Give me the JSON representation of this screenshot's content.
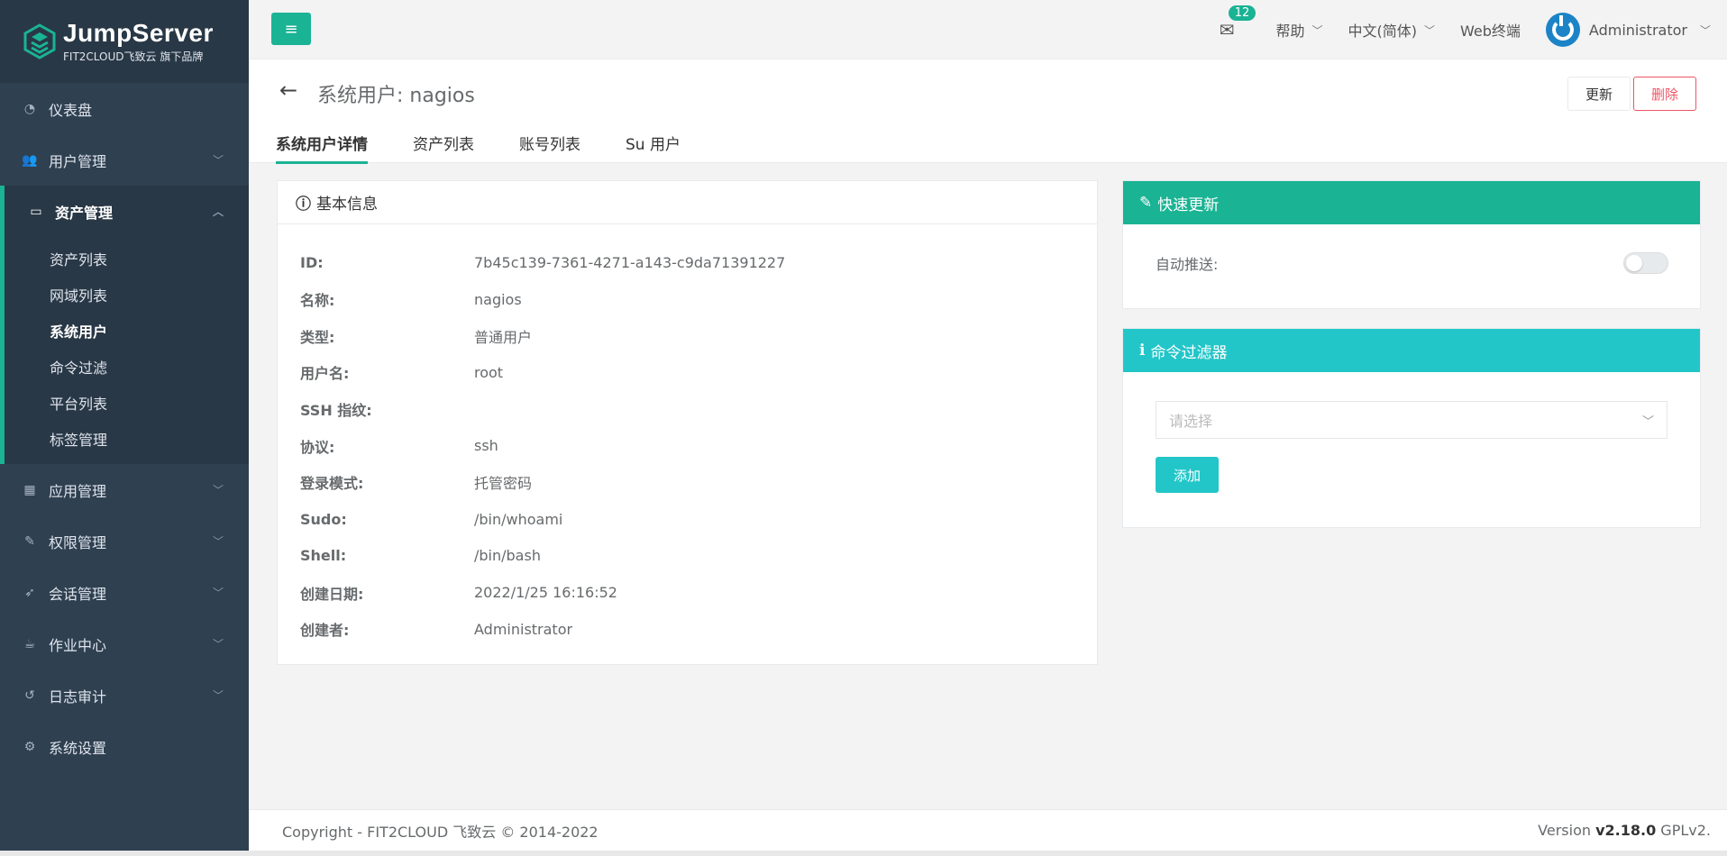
{
  "brand": {
    "title": "JumpServer",
    "subtitle": "FIT2CLOUD飞致云 旗下品牌"
  },
  "sidebar": {
    "items": [
      {
        "label": "仪表盘",
        "icon": "dashboard-icon"
      },
      {
        "label": "用户管理",
        "icon": "users-icon"
      },
      {
        "label": "资产管理",
        "icon": "inbox-icon"
      },
      {
        "label": "应用管理",
        "icon": "grid-icon"
      },
      {
        "label": "权限管理",
        "icon": "edit-icon"
      },
      {
        "label": "会话管理",
        "icon": "rocket-icon"
      },
      {
        "label": "作业中心",
        "icon": "coffee-icon"
      },
      {
        "label": "日志审计",
        "icon": "history-icon"
      },
      {
        "label": "系统设置",
        "icon": "cogs-icon"
      }
    ],
    "subitems": [
      "资产列表",
      "网域列表",
      "系统用户",
      "命令过滤",
      "平台列表",
      "标签管理"
    ]
  },
  "topbar": {
    "mail_count": "12",
    "help": "帮助",
    "language": "中文(简体)",
    "web_terminal": "Web终端",
    "user": "Administrator"
  },
  "header": {
    "title": "系统用户: nagios",
    "update": "更新",
    "delete": "删除",
    "tabs": [
      "系统用户详情",
      "资产列表",
      "账号列表",
      "Su 用户"
    ]
  },
  "info": {
    "title": "基本信息",
    "rows": [
      {
        "label": "ID:",
        "value": "7b45c139-7361-4271-a143-c9da71391227"
      },
      {
        "label": "名称:",
        "value": "nagios"
      },
      {
        "label": "类型:",
        "value": "普通用户"
      },
      {
        "label": "用户名:",
        "value": "root"
      },
      {
        "label": "SSH 指纹:",
        "value": ""
      },
      {
        "label": "协议:",
        "value": "ssh"
      },
      {
        "label": "登录模式:",
        "value": "托管密码"
      },
      {
        "label": "Sudo:",
        "value": "/bin/whoami"
      },
      {
        "label": "Shell:",
        "value": "/bin/bash"
      },
      {
        "label": "创建日期:",
        "value": "2022/1/25 16:16:52"
      },
      {
        "label": "创建者:",
        "value": "Administrator"
      }
    ]
  },
  "quick_update": {
    "title": "快速更新",
    "auto_push_label": "自动推送:",
    "auto_push_enabled": false
  },
  "command_filter": {
    "title": "命令过滤器",
    "placeholder": "请选择",
    "add": "添加"
  },
  "footer": {
    "copyright": "Copyright - FIT2CLOUD 飞致云 © 2014-2022",
    "version_prefix": "Version ",
    "version": "v2.18.0",
    "license": " GPLv2."
  },
  "colors": {
    "accent": "#1ab394",
    "info": "#23c6c8",
    "danger": "#ed5565",
    "sidebar": "#2f4050"
  }
}
